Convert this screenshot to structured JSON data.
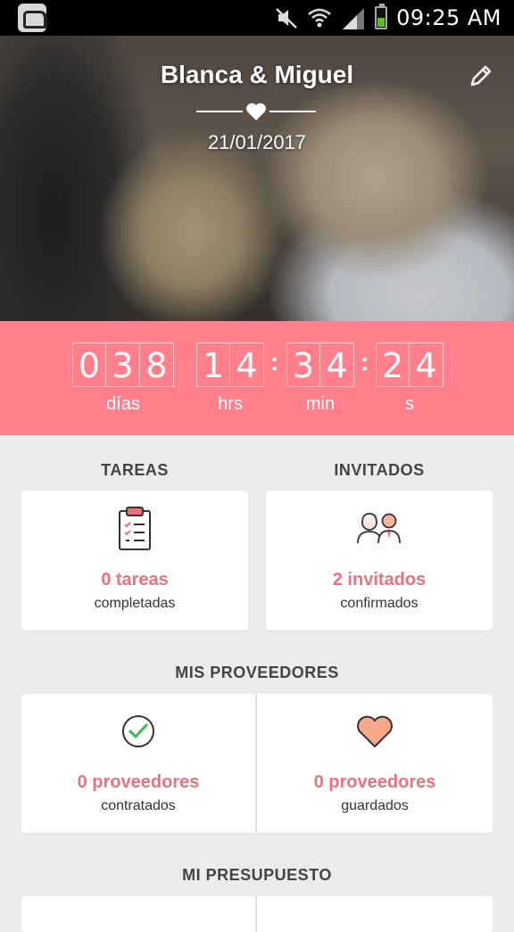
{
  "status_bar": {
    "time": "09:25 AM"
  },
  "hero": {
    "couple_name": "Blanca & Miguel",
    "wedding_date": "21/01/2017"
  },
  "countdown": {
    "days": [
      "0",
      "3",
      "8"
    ],
    "hours": [
      "1",
      "4"
    ],
    "minutes": [
      "3",
      "4"
    ],
    "seconds": [
      "2",
      "4"
    ],
    "days_label": "días",
    "hours_label": "hrs",
    "minutes_label": "min",
    "seconds_label": "s"
  },
  "sections": {
    "tareas": {
      "title": "TAREAS",
      "count_text": "0 tareas",
      "subtitle": "completadas"
    },
    "invitados": {
      "title": "INVITADOS",
      "count_text": "2 invitados",
      "subtitle": "confirmados"
    },
    "proveedores": {
      "title": "MIS PROVEEDORES",
      "contratados": {
        "count_text": "0 proveedores",
        "subtitle": "contratados"
      },
      "guardados": {
        "count_text": "0 proveedores",
        "subtitle": "guardados"
      }
    },
    "presupuesto": {
      "title": "MI PRESUPUESTO"
    }
  },
  "colors": {
    "accent": "#ff808c",
    "accent_text": "#e8727e",
    "background": "#ececec"
  },
  "icons": [
    "app-icon",
    "mute-icon",
    "wifi-icon",
    "signal-icon",
    "battery-icon",
    "edit-pencil-icon",
    "heart-divider-icon",
    "clipboard-icon",
    "guests-icon",
    "check-circle-icon",
    "heart-icon"
  ]
}
